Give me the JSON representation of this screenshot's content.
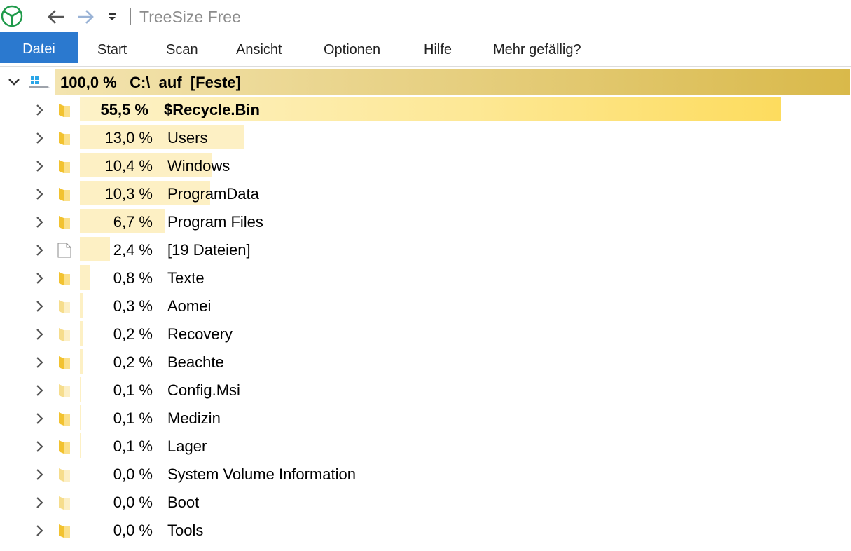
{
  "app": {
    "title": "TreeSize Free"
  },
  "ribbon": {
    "tabs": [
      {
        "label": "Datei",
        "active": true
      },
      {
        "label": "Start",
        "active": false
      },
      {
        "label": "Scan",
        "active": false
      },
      {
        "label": "Ansicht",
        "active": false
      },
      {
        "label": "Optionen",
        "active": false
      },
      {
        "label": "Hilfe",
        "active": false
      },
      {
        "label": "Mehr gefällig?",
        "active": false
      }
    ]
  },
  "tree": {
    "root": {
      "text": "100,0 %   C:\\  auf  [Feste]",
      "percent": 100.0,
      "icon": "drive-icon"
    },
    "items": [
      {
        "percent_label": "55,5 %",
        "name": "$Recycle.Bin",
        "percent": 55.5,
        "icon": "folder-icon",
        "bold": true
      },
      {
        "percent_label": "13,0 %",
        "name": "Users",
        "percent": 13.0,
        "icon": "folder-icon"
      },
      {
        "percent_label": "10,4 %",
        "name": "Windows",
        "percent": 10.4,
        "icon": "folder-icon"
      },
      {
        "percent_label": "10,3 %",
        "name": "ProgramData",
        "percent": 10.3,
        "icon": "folder-icon"
      },
      {
        "percent_label": "6,7 %",
        "name": "Program Files",
        "percent": 6.7,
        "icon": "folder-icon"
      },
      {
        "percent_label": "2,4 %",
        "name": "[19 Dateien]",
        "percent": 2.4,
        "icon": "file-icon"
      },
      {
        "percent_label": "0,8 %",
        "name": "Texte",
        "percent": 0.8,
        "icon": "folder-icon"
      },
      {
        "percent_label": "0,3 %",
        "name": "Aomei",
        "percent": 0.3,
        "icon": "folder-icon"
      },
      {
        "percent_label": "0,2 %",
        "name": "Recovery",
        "percent": 0.2,
        "icon": "folder-icon"
      },
      {
        "percent_label": "0,2 %",
        "name": "Beachte",
        "percent": 0.2,
        "icon": "folder-icon"
      },
      {
        "percent_label": "0,1 %",
        "name": "Config.Msi",
        "percent": 0.1,
        "icon": "folder-icon"
      },
      {
        "percent_label": "0,1 %",
        "name": "Medizin",
        "percent": 0.1,
        "icon": "folder-icon"
      },
      {
        "percent_label": "0,1 %",
        "name": "Lager",
        "percent": 0.1,
        "icon": "folder-icon"
      },
      {
        "percent_label": "0,0 %",
        "name": "System Volume Information",
        "percent": 0.0,
        "icon": "folder-icon"
      },
      {
        "percent_label": "0,0 %",
        "name": "Boot",
        "percent": 0.0,
        "icon": "folder-icon"
      },
      {
        "percent_label": "0,0 %",
        "name": "Tools",
        "percent": 0.0,
        "icon": "folder-icon"
      }
    ]
  },
  "colors": {
    "accent_tab": "#2b79cf",
    "bar_fill": "#fdf0c4",
    "bar_fill_strong": "#fddc5e",
    "root_bar": "#d9b94a"
  }
}
